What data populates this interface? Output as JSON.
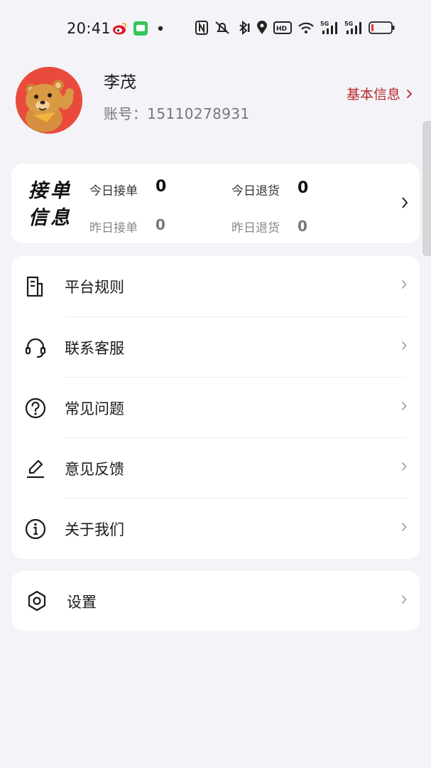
{
  "status_bar": {
    "time": "20:41",
    "signal_labels": [
      "5G",
      "5G"
    ],
    "hd_label": "HD"
  },
  "profile": {
    "name": "李茂",
    "account_label": "账号：",
    "account_number": "15110278931",
    "basic_info_label": "基本信息"
  },
  "orders": {
    "title_line1": "接单",
    "title_line2": "信息",
    "today_orders_label": "今日接单",
    "today_orders_value": "0",
    "today_returns_label": "今日退货",
    "today_returns_value": "0",
    "yesterday_orders_label": "昨日接单",
    "yesterday_orders_value": "0",
    "yesterday_returns_label": "昨日退货",
    "yesterday_returns_value": "0"
  },
  "menu": {
    "items": [
      {
        "label": "平台规则",
        "icon": "document-icon"
      },
      {
        "label": "联系客服",
        "icon": "headset-icon"
      },
      {
        "label": "常见问题",
        "icon": "question-icon"
      },
      {
        "label": "意见反馈",
        "icon": "edit-icon"
      },
      {
        "label": "关于我们",
        "icon": "info-icon"
      }
    ]
  },
  "settings": {
    "label": "设置",
    "icon": "hexagon-settings-icon"
  },
  "colors": {
    "background": "#f3f3f8",
    "card": "#ffffff",
    "accent_red": "#b52a2a",
    "avatar_bg": "#ea4a3c"
  }
}
